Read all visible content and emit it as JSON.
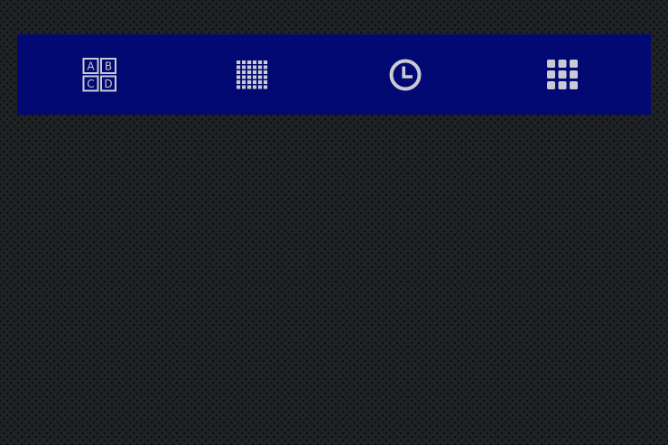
{
  "toolbar": {
    "background": "#000778",
    "icon_color": "#c9cad2",
    "buttons": [
      {
        "id": "abcd",
        "icon": "abcd-choice-icon",
        "letters": [
          "A",
          "B",
          "C",
          "D"
        ]
      },
      {
        "id": "grid",
        "icon": "dense-grid-icon"
      },
      {
        "id": "clock",
        "icon": "clock-icon"
      },
      {
        "id": "apps",
        "icon": "apps-grid-icon"
      }
    ]
  }
}
